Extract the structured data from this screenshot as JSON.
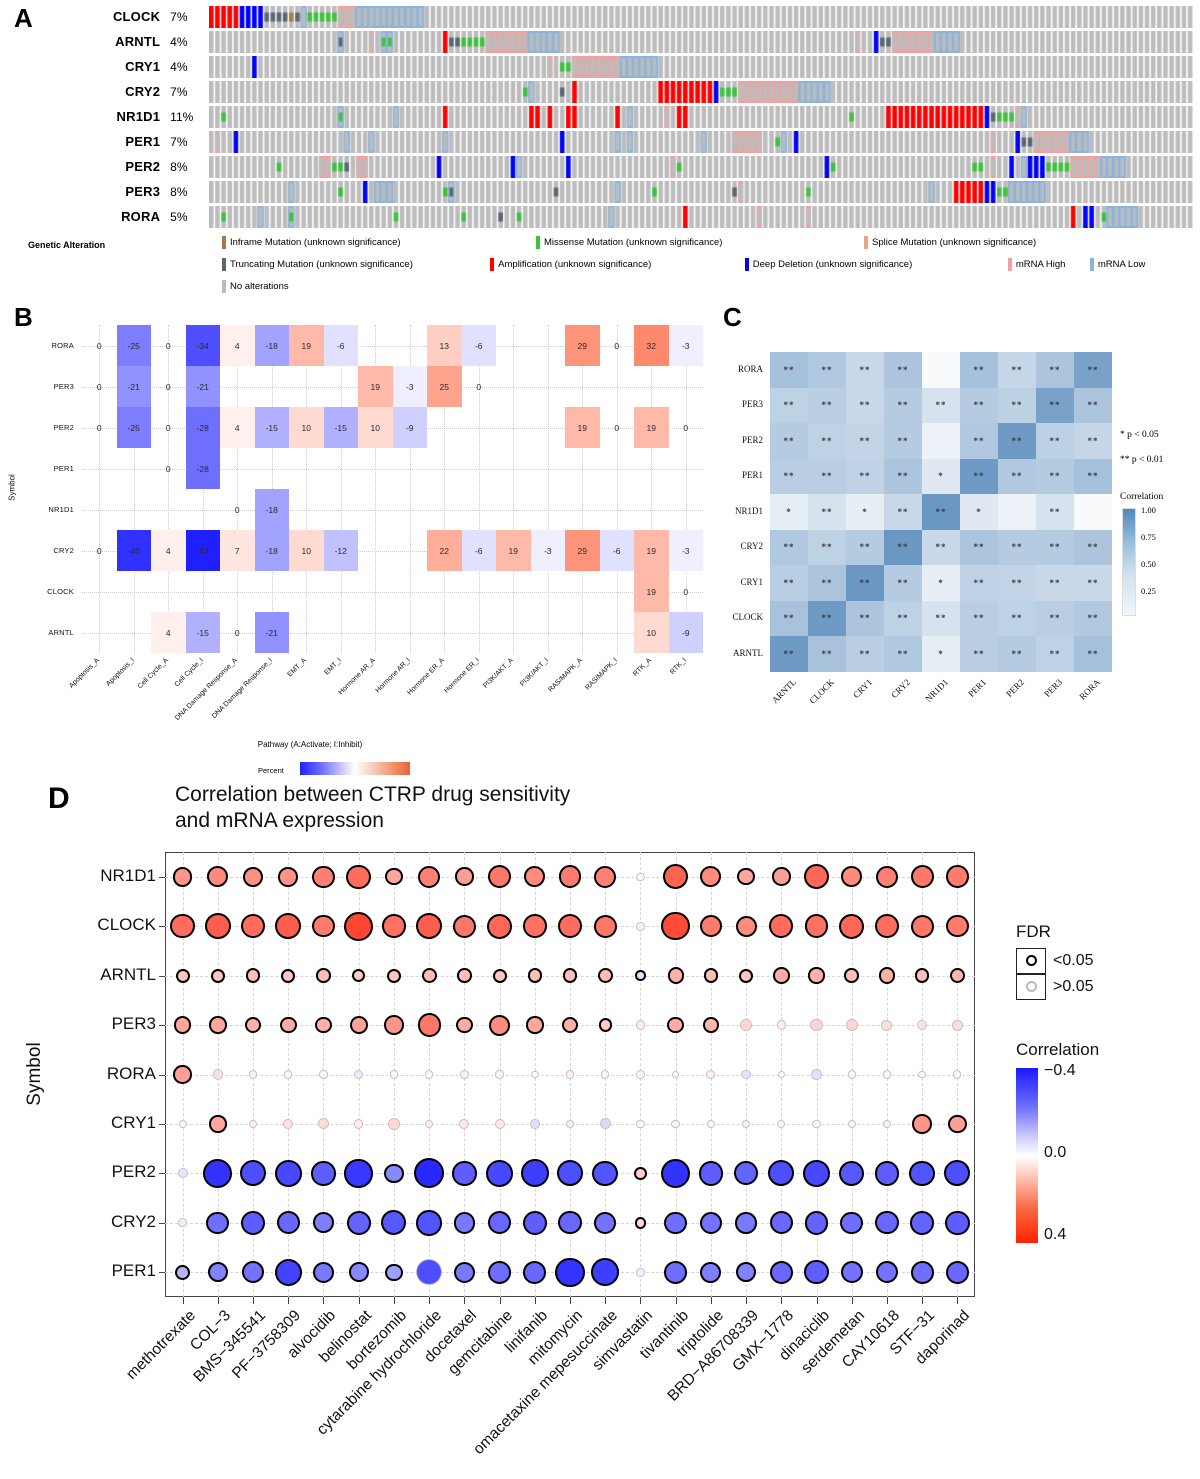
{
  "panels": {
    "a": {
      "letter": "A"
    },
    "b": {
      "letter": "B"
    },
    "c": {
      "letter": "C"
    },
    "d": {
      "letter": "D"
    }
  },
  "panelA": {
    "genes": [
      {
        "symbol": "CLOCK",
        "pct": "7%"
      },
      {
        "symbol": "ARNTL",
        "pct": "4%"
      },
      {
        "symbol": "CRY1",
        "pct": "4%"
      },
      {
        "symbol": "CRY2",
        "pct": "7%"
      },
      {
        "symbol": "NR1D1",
        "pct": "11%"
      },
      {
        "symbol": "PER1",
        "pct": "7%"
      },
      {
        "symbol": "PER2",
        "pct": "8%"
      },
      {
        "symbol": "PER3",
        "pct": "8%"
      },
      {
        "symbol": "RORA",
        "pct": "5%"
      }
    ],
    "legend_title": "Genetic Alteration",
    "legend_items": [
      {
        "label": "Inframe Mutation (unknown significance)",
        "color": "#a57a4c"
      },
      {
        "label": "Missense Mutation (unknown significance)",
        "color": "#3ec13e"
      },
      {
        "label": "Splice Mutation (unknown significance)",
        "color": "#e8a87c"
      },
      {
        "label": "Truncating Mutation (unknown significance)",
        "color": "#5a6672"
      },
      {
        "label": "Amplification (unknown significance)",
        "color": "#ff0000"
      },
      {
        "label": "Deep Deletion (unknown significance)",
        "color": "#0000ff"
      },
      {
        "label": "mRNA High",
        "color": "#f4a0a0"
      },
      {
        "label": "mRNA Low",
        "color": "#8ab4dc"
      },
      {
        "label": "No alterations",
        "color": "#bcbcbc"
      }
    ],
    "colors": {
      "background": "#bcbcbc",
      "amplification": "#ff0000",
      "deep_deletion": "#0000ff",
      "missense": "#3ec13e",
      "truncating": "#5a6672",
      "inframe": "#a57a4c",
      "splice": "#e8a87c",
      "mrna_high": "#f4a0a0",
      "mrna_low": "#8ab4dc"
    }
  },
  "chart_data": [
    {
      "panel": "B",
      "type": "heatmap",
      "title": "",
      "ylabel": "Symbol",
      "legend_title": "Pathway (A:Activate; I:Inhibit)",
      "legend_label": "Percent",
      "rows": [
        "RORA",
        "PER3",
        "PER2",
        "PER1",
        "NR1D1",
        "CRY2",
        "CLOCK",
        "ARNTL"
      ],
      "columns": [
        "Apoptosis_A",
        "Apoptosis_I",
        "Cell Cycle_A",
        "Cell Cycle_I",
        "DNA Damage Response_A",
        "DNA Damage Response_I",
        "EMT_A",
        "EMT_I",
        "Hormone AR_A",
        "Hormone AR_I",
        "Hormone ER_A",
        "Hormone ER_I",
        "PI3K/AKT_A",
        "PI3K/AKT_I",
        "RAS/MAPK_A",
        "RAS/MAPK_I",
        "RTK_A",
        "RTK_I"
      ],
      "values": [
        [
          0,
          -25,
          0,
          -34,
          4,
          -18,
          19,
          -6,
          null,
          null,
          13,
          -6,
          null,
          null,
          29,
          0,
          32,
          -3
        ],
        [
          0,
          -21,
          0,
          -21,
          null,
          null,
          null,
          null,
          19,
          -3,
          25,
          0,
          null,
          null,
          null,
          null,
          null,
          null
        ],
        [
          0,
          -25,
          0,
          -28,
          4,
          -15,
          10,
          -15,
          10,
          -9,
          null,
          null,
          null,
          null,
          19,
          0,
          19,
          0
        ],
        [
          null,
          null,
          0,
          -28,
          null,
          null,
          null,
          null,
          null,
          null,
          null,
          null,
          null,
          null,
          null,
          null,
          null,
          null
        ],
        [
          null,
          null,
          null,
          null,
          0,
          -18,
          null,
          null,
          null,
          null,
          null,
          null,
          null,
          null,
          null,
          null,
          null,
          null
        ],
        [
          0,
          -40,
          4,
          -43,
          7,
          -18,
          10,
          -12,
          null,
          null,
          22,
          -6,
          19,
          -3,
          29,
          -6,
          19,
          -3
        ],
        [
          null,
          null,
          null,
          null,
          null,
          null,
          null,
          null,
          null,
          null,
          null,
          null,
          null,
          null,
          null,
          null,
          19,
          0
        ],
        [
          null,
          null,
          4,
          -15,
          0,
          -21,
          null,
          null,
          null,
          null,
          null,
          null,
          null,
          null,
          null,
          null,
          10,
          -9
        ]
      ],
      "vmin": -43,
      "vmax": 32
    },
    {
      "panel": "C",
      "type": "heatmap",
      "title": "",
      "legend_title": "Correlation",
      "legend_ticks": [
        "1.00",
        "0.75",
        "0.50",
        "0.25"
      ],
      "sig_legend": [
        "* p < 0.05",
        "** p < 0.01"
      ],
      "rows": [
        "RORA",
        "PER3",
        "PER2",
        "PER1",
        "NR1D1",
        "CRY2",
        "CRY1",
        "CLOCK",
        "ARNTL"
      ],
      "columns": [
        "ARNTL",
        "CLOCK",
        "CRY1",
        "CRY2",
        "NR1D1",
        "PER1",
        "PER2",
        "PER3",
        "RORA"
      ],
      "values": [
        [
          0.48,
          0.42,
          0.3,
          0.45,
          0.04,
          0.48,
          0.32,
          0.45,
          0.72
        ],
        [
          0.35,
          0.38,
          0.3,
          0.4,
          0.22,
          0.4,
          0.36,
          0.72,
          0.45
        ],
        [
          0.4,
          0.35,
          0.33,
          0.4,
          0.1,
          0.42,
          0.78,
          0.36,
          0.32
        ],
        [
          0.38,
          0.38,
          0.34,
          0.45,
          0.17,
          0.78,
          0.42,
          0.4,
          0.48
        ],
        [
          0.14,
          0.22,
          0.13,
          0.3,
          0.8,
          0.17,
          0.1,
          0.22,
          0.04
        ],
        [
          0.42,
          0.35,
          0.4,
          0.8,
          0.3,
          0.45,
          0.4,
          0.4,
          0.45
        ],
        [
          0.38,
          0.45,
          0.8,
          0.4,
          0.13,
          0.34,
          0.33,
          0.3,
          0.3
        ],
        [
          0.47,
          0.78,
          0.45,
          0.35,
          0.22,
          0.38,
          0.35,
          0.38,
          0.42
        ],
        [
          0.78,
          0.47,
          0.38,
          0.42,
          0.14,
          0.38,
          0.4,
          0.35,
          0.48
        ]
      ],
      "stars": [
        [
          "**",
          "**",
          "**",
          "**",
          "",
          "**",
          "**",
          "**",
          "**"
        ],
        [
          "**",
          "**",
          "**",
          "**",
          "**",
          "**",
          "**",
          "**",
          "**"
        ],
        [
          "**",
          "**",
          "**",
          "**",
          "",
          "**",
          "**",
          "**",
          "**"
        ],
        [
          "**",
          "**",
          "**",
          "**",
          "*",
          "**",
          "**",
          "**",
          "**"
        ],
        [
          "*",
          "**",
          "*",
          "**",
          "**",
          "*",
          "",
          "**",
          ""
        ],
        [
          "**",
          "**",
          "**",
          "**",
          "**",
          "**",
          "**",
          "**",
          "**"
        ],
        [
          "**",
          "**",
          "**",
          "**",
          "*",
          "**",
          "**",
          "**",
          "**"
        ],
        [
          "**",
          "**",
          "**",
          "**",
          "**",
          "**",
          "**",
          "**",
          "**"
        ],
        [
          "**",
          "**",
          "**",
          "**",
          "*",
          "**",
          "**",
          "**",
          "**"
        ]
      ]
    },
    {
      "panel": "D",
      "type": "scatter",
      "title": "Correlation between CTRP drug sensitivity\nand mRNA expression",
      "ylabel": "Symbol",
      "legend_fdr_title": "FDR",
      "legend_fdr_items": [
        "<0.05",
        ">0.05"
      ],
      "legend_cor_title": "Correlation",
      "legend_cor_ticks": [
        "−0.4",
        "0.0",
        "0.4"
      ],
      "rows": [
        "NR1D1",
        "CLOCK",
        "ARNTL",
        "PER3",
        "RORA",
        "CRY1",
        "PER2",
        "CRY2",
        "PER1"
      ],
      "columns": [
        "methotrexate",
        "COL−3",
        "BMS−345541",
        "PF−3758309",
        "alvocidib",
        "belinostat",
        "bortezomib",
        "cytarabine hydrochloride",
        "docetaxel",
        "gemcitabine",
        "linifanib",
        "mitomycin",
        "omacetaxine mepesuccinate",
        "simvastatin",
        "tivantinib",
        "triptolide",
        "BRD−A86708339",
        "GMX−1778",
        "dinaciclib",
        "serdemetan",
        "CAY10618",
        "STF−31",
        "daporinad"
      ],
      "correlations": [
        [
          0.22,
          0.24,
          0.23,
          0.22,
          0.26,
          0.3,
          0.18,
          0.26,
          0.2,
          0.28,
          0.24,
          0.27,
          0.26,
          0.02,
          0.32,
          0.24,
          0.18,
          0.2,
          0.31,
          0.24,
          0.26,
          0.28,
          0.27
        ],
        [
          0.3,
          0.33,
          0.3,
          0.33,
          0.27,
          0.38,
          0.29,
          0.33,
          0.28,
          0.31,
          0.29,
          0.3,
          0.28,
          0.03,
          0.37,
          0.27,
          0.24,
          0.3,
          0.29,
          0.31,
          0.3,
          0.28,
          0.27
        ],
        [
          0.12,
          0.12,
          0.13,
          0.12,
          0.13,
          0.11,
          0.12,
          0.14,
          0.13,
          0.12,
          0.13,
          0.13,
          0.14,
          -0.06,
          0.16,
          0.13,
          0.12,
          0.17,
          0.16,
          0.13,
          0.16,
          0.13,
          0.15
        ],
        [
          0.18,
          0.18,
          0.16,
          0.17,
          0.16,
          0.19,
          0.22,
          0.28,
          0.17,
          0.24,
          0.18,
          0.16,
          0.11,
          0.04,
          0.17,
          0.15,
          0.08,
          0.04,
          0.09,
          0.08,
          0.07,
          0.06,
          0.07
        ],
        [
          0.2,
          0.06,
          0.03,
          0.02,
          0.02,
          -0.04,
          0.02,
          0.02,
          0.03,
          0.02,
          0.01,
          0.03,
          0.02,
          0.02,
          0.01,
          0.03,
          -0.05,
          0.01,
          -0.06,
          0.02,
          0.02,
          0.01,
          0.02
        ],
        [
          0.02,
          0.18,
          0.03,
          0.06,
          0.07,
          0.04,
          0.08,
          0.03,
          0.05,
          0.05,
          -0.06,
          0.03,
          -0.07,
          0.02,
          0.03,
          0.02,
          0.03,
          0.02,
          0.02,
          0.02,
          0.03,
          0.22,
          0.2
        ],
        [
          -0.05,
          -0.38,
          -0.33,
          -0.34,
          -0.3,
          -0.37,
          -0.22,
          -0.4,
          -0.3,
          -0.34,
          -0.36,
          -0.33,
          -0.32,
          0.1,
          -0.38,
          -0.3,
          -0.29,
          -0.33,
          -0.34,
          -0.31,
          -0.3,
          -0.32,
          -0.33
        ],
        [
          -0.03,
          -0.27,
          -0.3,
          -0.28,
          -0.24,
          -0.29,
          -0.31,
          -0.32,
          -0.25,
          -0.28,
          -0.3,
          -0.28,
          -0.26,
          0.08,
          -0.27,
          -0.26,
          -0.25,
          -0.28,
          -0.29,
          -0.27,
          -0.28,
          -0.29,
          -0.3
        ],
        [
          -0.14,
          -0.23,
          -0.26,
          -0.35,
          -0.25,
          -0.22,
          -0.18,
          -0.33,
          -0.25,
          -0.27,
          -0.28,
          -0.38,
          -0.36,
          -0.03,
          -0.27,
          -0.24,
          -0.23,
          -0.28,
          -0.3,
          -0.26,
          -0.26,
          -0.27,
          -0.28
        ]
      ],
      "significant": [
        [
          1,
          1,
          1,
          1,
          1,
          1,
          1,
          1,
          1,
          1,
          1,
          1,
          1,
          0,
          1,
          1,
          1,
          1,
          1,
          1,
          1,
          1,
          1
        ],
        [
          1,
          1,
          1,
          1,
          1,
          1,
          1,
          1,
          1,
          1,
          1,
          1,
          1,
          0,
          1,
          1,
          1,
          1,
          1,
          1,
          1,
          1,
          1
        ],
        [
          1,
          1,
          1,
          1,
          1,
          1,
          1,
          1,
          1,
          1,
          1,
          1,
          1,
          1,
          1,
          1,
          1,
          1,
          1,
          1,
          1,
          1,
          1
        ],
        [
          1,
          1,
          1,
          1,
          1,
          1,
          1,
          1,
          1,
          1,
          1,
          1,
          1,
          0,
          1,
          1,
          0,
          0,
          0,
          0,
          0,
          0,
          0
        ],
        [
          1,
          0,
          0,
          0,
          0,
          0,
          0,
          0,
          0,
          0,
          0,
          0,
          0,
          0,
          0,
          0,
          0,
          0,
          0,
          0,
          0,
          0,
          0
        ],
        [
          0,
          1,
          0,
          0,
          0,
          0,
          0,
          0,
          0,
          0,
          0,
          0,
          0,
          0,
          0,
          0,
          0,
          0,
          0,
          0,
          0,
          1,
          1
        ],
        [
          0,
          1,
          1,
          1,
          1,
          1,
          1,
          1,
          1,
          1,
          1,
          1,
          1,
          1,
          1,
          1,
          1,
          1,
          1,
          1,
          1,
          1,
          1
        ],
        [
          0,
          1,
          1,
          1,
          1,
          1,
          1,
          1,
          1,
          1,
          1,
          1,
          1,
          1,
          1,
          1,
          1,
          1,
          1,
          1,
          1,
          1,
          1
        ],
        [
          1,
          1,
          1,
          1,
          1,
          1,
          1,
          0,
          1,
          1,
          1,
          1,
          1,
          0,
          1,
          1,
          1,
          1,
          1,
          1,
          1,
          1,
          1
        ]
      ]
    }
  ]
}
